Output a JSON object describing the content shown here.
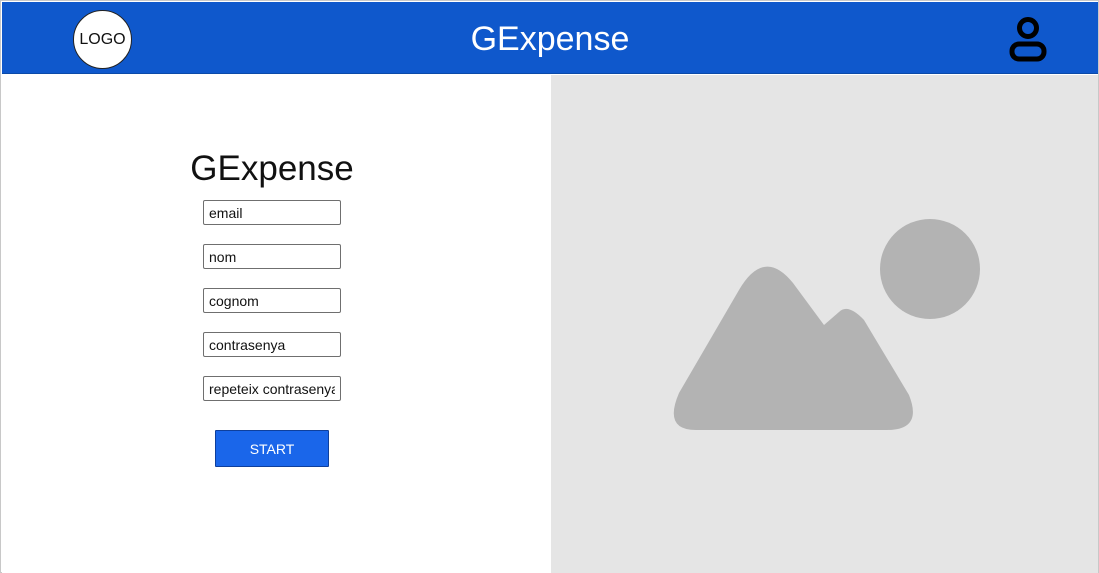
{
  "header": {
    "logo_text": "LOGO",
    "title": "GExpense",
    "user_icon": "user-icon",
    "background_color": "#0f58cc"
  },
  "form": {
    "title": "GExpense",
    "fields": {
      "email": {
        "placeholder": "email",
        "value": ""
      },
      "nom": {
        "placeholder": "nom",
        "value": ""
      },
      "cognom": {
        "placeholder": "cognom",
        "value": ""
      },
      "contrasenya": {
        "placeholder": "contrasenya",
        "value": ""
      },
      "repeteix": {
        "placeholder": "repeteix contrasenya",
        "value": ""
      }
    },
    "submit_label": "START",
    "button_color": "#1a66ea"
  },
  "image_panel": {
    "icon": "image-placeholder-icon",
    "background_color": "#e5e5e5",
    "shape_color": "#b3b3b3"
  }
}
